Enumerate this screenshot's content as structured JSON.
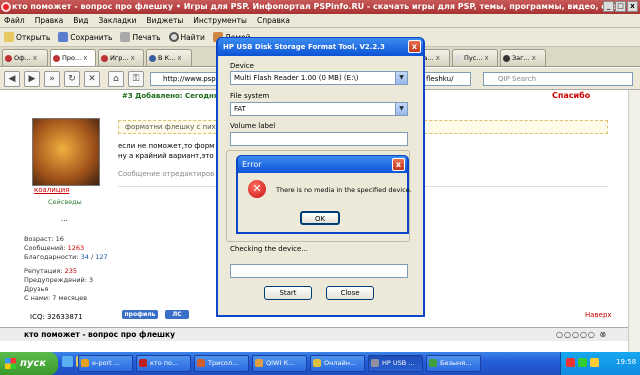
{
  "browser": {
    "title": "кто поможет - вопрос про флешку • Игры для PSP. Инфопортал PSPinfo.RU - скачать игры для PSP, темы, программы, видео, обои, ... - Opera",
    "menu": [
      "Файл",
      "Правка",
      "Вид",
      "Закладки",
      "Виджеты",
      "Инструменты",
      "Справка"
    ],
    "toolbar": {
      "open": "Открыть",
      "save": "Сохранить",
      "print": "Печать",
      "find": "Найти",
      "home": "Домой"
    },
    "tabs": [
      "Оф...",
      "Про...",
      "Игр...",
      "В К...",
      "ска...",
      "Пус...",
      "Заг..."
    ],
    "url": "http://www.pspi",
    "url_tail": "fleshku/",
    "search_placeholder": "QIP Search"
  },
  "forum": {
    "post_number": "#3 Добавлено: Сегодня в",
    "thanks": "Спасибо",
    "username": "коалиция",
    "user_title": "Сейсведы",
    "user_dots": "...",
    "info": {
      "age_label": "Возраст:",
      "age": "16",
      "messages_label": "Сообщений:",
      "messages": "1263",
      "thanks_label": "Благодарности:",
      "thanks_given": "34",
      "thanks_received": "127",
      "rep_label": "Репутация:",
      "rep": "235",
      "warn_label": "Предупреждений:",
      "warn": "3",
      "friends_label": "Друзья",
      "since_label": "С нами:",
      "since": "7 месяцев"
    },
    "quote": "форматни флешку с пихи",
    "post_line1": "если не поможет,то форм",
    "post_line2": "ну а крайний вариант,это",
    "edited": "Сообщение отредактиров",
    "profile_btn": "профиль",
    "pm_btn": "ЛС",
    "icq": "ICQ: 32633871",
    "top_link": "Наверх",
    "topic_footer": "кто поможет - вопрос про флешку"
  },
  "format_tool": {
    "title": "HP USB Disk Storage Format Tool, V2.2.3",
    "device_label": "Device",
    "device_value": "Multi   Flash Reader    1.00 (0 MB) (E:\\)",
    "fs_label": "File system",
    "fs_value": "FAT",
    "volume_label": "Volume label",
    "volume_value": "",
    "checking": "Checking the device...",
    "start": "Start",
    "close": "Close"
  },
  "error_dialog": {
    "title": "Error",
    "message": "There is no media in the specified device.",
    "ok": "OK"
  },
  "taskbar": {
    "start": "пуск",
    "tasks": [
      {
        "label": "e-port ...",
        "color": "#e8a020"
      },
      {
        "label": "кто по...",
        "color": "#c02020"
      },
      {
        "label": "Трисол...",
        "color": "#d06030"
      },
      {
        "label": "QIWI К...",
        "color": "#e0a040"
      },
      {
        "label": "Онлайн...",
        "color": "#e0c040"
      },
      {
        "label": "HP USB ...",
        "color": "#9090a0"
      },
      {
        "label": "Безыня...",
        "color": "#40a040"
      }
    ],
    "clock": "19:58"
  }
}
